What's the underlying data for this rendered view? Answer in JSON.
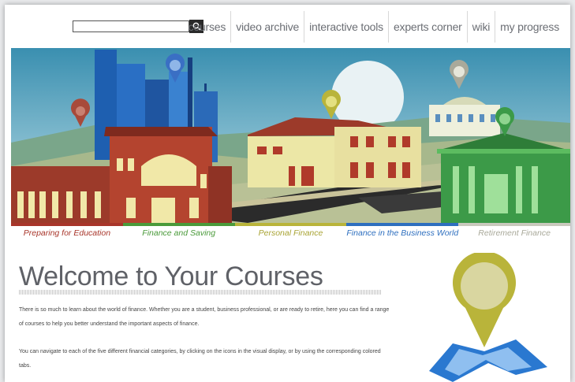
{
  "search": {
    "placeholder": "",
    "button_icon": "search-icon"
  },
  "nav": {
    "items": [
      {
        "label": "courses"
      },
      {
        "label": "video archive"
      },
      {
        "label": "interactive tools"
      },
      {
        "label": "experts corner"
      },
      {
        "label": "wiki"
      },
      {
        "label": "my progress"
      }
    ]
  },
  "categories": [
    {
      "label": "Preparing for Education",
      "color": "#a8352a"
    },
    {
      "label": "Finance and Saving",
      "color": "#4a9a3a"
    },
    {
      "label": "Personal Finance",
      "color": "#b9b43a"
    },
    {
      "label": "Finance in the Business World",
      "color": "#2e6fbf"
    },
    {
      "label": "Retirement Finance",
      "color": "#a9a99a"
    }
  ],
  "main": {
    "title": "Welcome to Your Courses",
    "paragraph1": "There is so much to learn about the world of finance. Whether you are a student, business professional, or are ready to retire, here you can find a range of courses to help you better understand the important aspects of finance.",
    "paragraph2": "You can navigate to each of the five different financial categories, by clicking on the icons in the visual display, or by using the corresponding colored tabs."
  }
}
